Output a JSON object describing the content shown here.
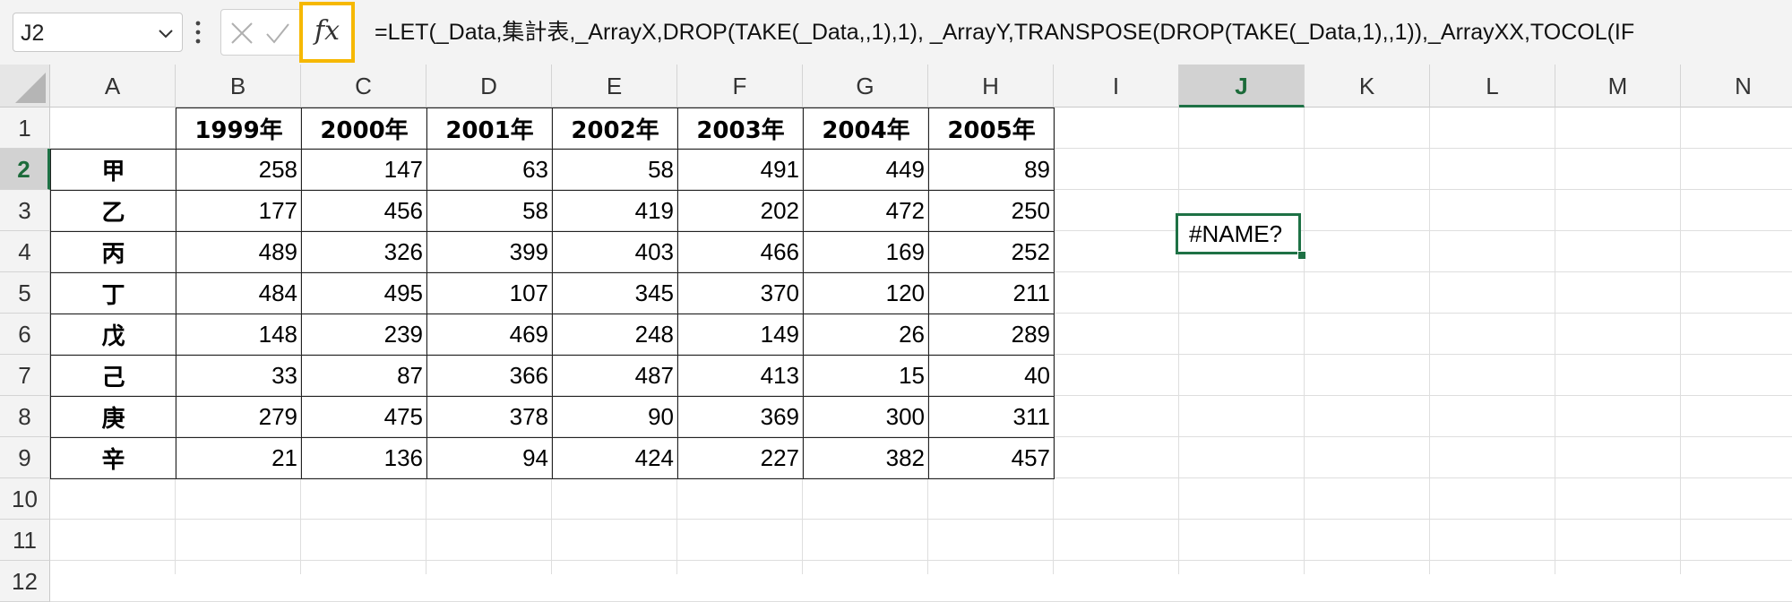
{
  "name_box": {
    "value": "J2"
  },
  "formula_bar": {
    "insert_function_label": "fx",
    "formula": "=LET(_Data,集計表,_ArrayX,DROP(TAKE(_Data,,1),1), _ArrayY,TRANSPOSE(DROP(TAKE(_Data,1),,1)),_ArrayXX,TOCOL(IF"
  },
  "columns": [
    "A",
    "B",
    "C",
    "D",
    "E",
    "F",
    "G",
    "H",
    "I",
    "J",
    "K",
    "L",
    "M",
    "N"
  ],
  "active_column": "J",
  "rows": [
    "1",
    "2",
    "3",
    "4",
    "5",
    "6",
    "7",
    "8",
    "9",
    "10",
    "11",
    "12"
  ],
  "active_row": "2",
  "table": {
    "years": [
      "1999年",
      "2000年",
      "2001年",
      "2002年",
      "2003年",
      "2004年",
      "2005年"
    ],
    "rows": [
      {
        "label": "甲",
        "values": [
          "258",
          "147",
          "63",
          "58",
          "491",
          "449",
          "89"
        ]
      },
      {
        "label": "乙",
        "values": [
          "177",
          "456",
          "58",
          "419",
          "202",
          "472",
          "250"
        ]
      },
      {
        "label": "丙",
        "values": [
          "489",
          "326",
          "399",
          "403",
          "466",
          "169",
          "252"
        ]
      },
      {
        "label": "丁",
        "values": [
          "484",
          "495",
          "107",
          "345",
          "370",
          "120",
          "211"
        ]
      },
      {
        "label": "戊",
        "values": [
          "148",
          "239",
          "469",
          "248",
          "149",
          "26",
          "289"
        ]
      },
      {
        "label": "己",
        "values": [
          "33",
          "87",
          "366",
          "487",
          "413",
          "15",
          "40"
        ]
      },
      {
        "label": "庚",
        "values": [
          "279",
          "475",
          "378",
          "90",
          "369",
          "300",
          "311"
        ]
      },
      {
        "label": "辛",
        "values": [
          "21",
          "136",
          "94",
          "424",
          "227",
          "382",
          "457"
        ]
      }
    ]
  },
  "active_cell": {
    "value": "#NAME?"
  },
  "colors": {
    "accent_green": "#1e7145",
    "fx_highlight": "#f6b800"
  },
  "icons": [
    "chevron-down-icon",
    "more-dots-icon",
    "cancel-icon",
    "enter-check-icon",
    "insert-function-icon"
  ]
}
